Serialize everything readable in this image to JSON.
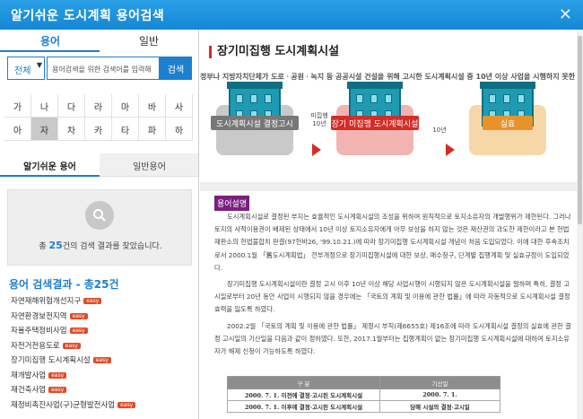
{
  "window": {
    "title": "알기쉬운 도시계획 용어검색",
    "close": "✕"
  },
  "left": {
    "tabs": [
      {
        "label": "용어"
      },
      {
        "label": "일반"
      }
    ],
    "search": {
      "select": "전체",
      "placeholder": "용어검색을 위한 검색어를 입력해",
      "button": "검색"
    },
    "consonants": [
      "가",
      "나",
      "다",
      "라",
      "마",
      "바",
      "사",
      "아",
      "자",
      "차",
      "카",
      "타",
      "파",
      "하"
    ],
    "selected_consonant": "자",
    "subtabs": [
      {
        "label": "알기쉬운 용어"
      },
      {
        "label": "일반용어"
      }
    ],
    "result_box": {
      "prefix": "총 ",
      "count": "25",
      "suffix": "건의 검색 결과를 찾았습니다."
    },
    "results_title": "용어 검색결과 - 총25건",
    "easy_badge": "easy",
    "results": [
      {
        "label": "자연재해위험개선지구",
        "easy": true
      },
      {
        "label": "자연환경보전지역",
        "easy": true
      },
      {
        "label": "자율주택정비사업",
        "easy": true
      },
      {
        "label": "자전거전용도로",
        "easy": true
      },
      {
        "label": "장기미집행 도시계획시설",
        "easy": true
      },
      {
        "label": "재개발사업",
        "easy": true
      },
      {
        "label": "재건축사업",
        "easy": true
      },
      {
        "label": "재정비촉진사업(구)균형발전사업",
        "easy": true
      }
    ]
  },
  "right": {
    "term_title": "장기미집행 도시계획시설",
    "subtitle": "정부나 지방자치단체가 도로ㆍ공원ㆍ녹지 등 공공시설 건설을 위해 고시한 도시계획시설 중 10년 이상 사업을 시행하지 못한 시설",
    "stages": [
      {
        "label": "도시계획시설 결정고시"
      },
      {
        "label": "장기 미집행 도시계획시설"
      },
      {
        "label": "실효"
      }
    ],
    "arrow1_text": "미집행\n10년",
    "arrow2_text": "10년",
    "section_tag": "용어설명",
    "paragraphs": [
      "도시계획시설로 결정된 부지는 효율적인 도시계획시설의 조성을 위하여 원칙적으로 토지소유자의 개발행위가 제한된다. 그러나 토지의 사적이용권이 배제된 상태에서 10년 이상 토지소유자에게 아무 보상을 하지 않는 것은 재산권의 과도한 제한이라고 본 헌법재판소의 헌법불합치 판결(97헌바26, '99.10.21.)에 따라 장기미집행 도시계획시설 개념이 처음 도입되었다. 이에 대한 후속조치로서 2000.1월 「舊도시계획법」 전부개정으로 장기미집행시설에 대한 보상, 매수청구, 단계별 집행계획 및 실효규정이 도입되었다.",
      "장기미집행 도시계획시설이란 결정 고시 이후 10년 이상 해당 사업시행이 시행되지 않은 도시계획시설을 말하며 특히, 결정 고시일로부터 20년 동안 사업이 시행되지 않을 경우에는 「국토의 계획 및 이용에 관한 법률」에 따라 자동적으로 도시계획시설 결정 효력을 잃도록 하였다.",
      "2002.2월 「국토의 계획 및 이용에 관한 법률」 제정시 부칙(제6655호) 제16조에 따라 도시계획시설 결정의 실효에 관한 결정 고시일의 기산일을 다음과 같이 정하였다. 또한, 2017.1월부터는 집행계획이 없는 장기미집행 도시계획시설에 대하여 토지소유자가 해제 신청이 가능하도록 하였다."
    ],
    "table": {
      "headers": [
        "구 분",
        "기산일"
      ],
      "rows": [
        [
          "2000. 7. 1. 이전에 결정·고시된 도시계획시설",
          "2000. 7. 1."
        ],
        [
          "2000. 7. 1. 이후에 결정·고시된 도시계획시설",
          "당해 시설의 결정·고시일"
        ]
      ]
    }
  }
}
